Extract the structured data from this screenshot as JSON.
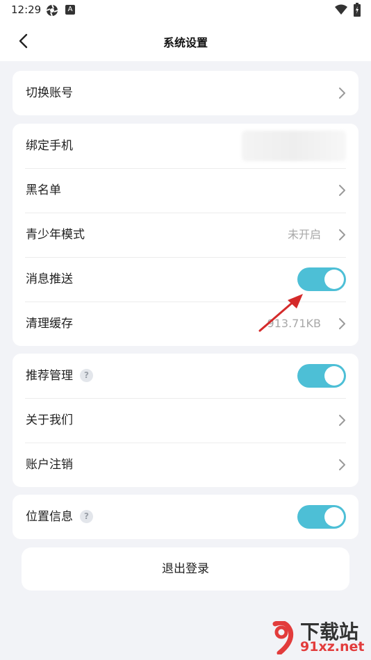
{
  "status_bar": {
    "time": "12:29",
    "badge": "A"
  },
  "header": {
    "title": "系统设置"
  },
  "card1": {
    "items": [
      {
        "label": "切换账号"
      }
    ]
  },
  "card2": {
    "items": [
      {
        "label": "绑定手机"
      },
      {
        "label": "黑名单"
      },
      {
        "label": "青少年模式",
        "value": "未开启"
      },
      {
        "label": "消息推送",
        "toggle": true
      },
      {
        "label": "清理缓存",
        "value": "913.71KB"
      }
    ]
  },
  "card3": {
    "items": [
      {
        "label": "推荐管理",
        "help": "?",
        "toggle": true
      },
      {
        "label": "关于我们"
      },
      {
        "label": "账户注销"
      }
    ]
  },
  "card4": {
    "items": [
      {
        "label": "位置信息",
        "help": "?",
        "toggle": true
      }
    ]
  },
  "logout": {
    "label": "退出登录"
  },
  "watermark": {
    "line1": "下载站",
    "line2": "91xz.net"
  },
  "colors": {
    "accent": "#4dbfd6",
    "background": "#f2f3f7",
    "arrow": "#d42a2a"
  }
}
